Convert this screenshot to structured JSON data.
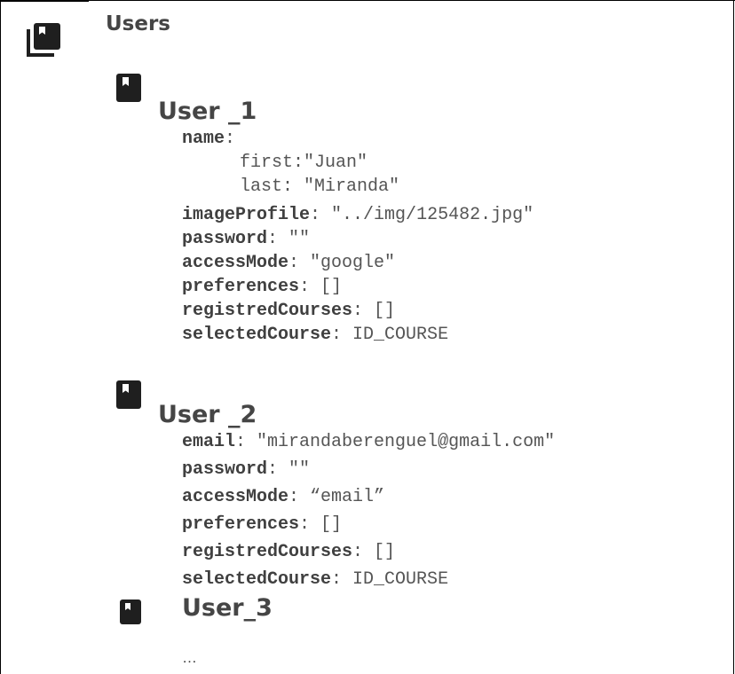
{
  "root": {
    "title": "Users",
    "icon": "collection-bookmark-icon"
  },
  "users": [
    {
      "title": "User _1",
      "icon": "bookmark-icon",
      "fields": [
        {
          "key": "name",
          "sep": ":",
          "value": ""
        },
        {
          "key": "",
          "sep": "",
          "value": "first:\"Juan\""
        },
        {
          "key": "",
          "sep": "",
          "value": "last: \"Miranda\""
        },
        {
          "key": "imageProfile",
          "sep": ": ",
          "value": "\"../img/125482.jpg\""
        },
        {
          "key": "password",
          "sep": ": ",
          "value": "\"\""
        },
        {
          "key": "accessMode",
          "sep": ": ",
          "value": "\"google\""
        },
        {
          "key": "preferences",
          "sep": ": ",
          "value": "[]"
        },
        {
          "key": "registredCourses",
          "sep": ": ",
          "value": "[]"
        },
        {
          "key": "selectedCourse",
          "sep": ": ",
          "value": "ID_COURSE"
        }
      ]
    },
    {
      "title": "User _2",
      "icon": "bookmark-icon",
      "fields": [
        {
          "key": "email",
          "sep": ": ",
          "value": "\"mirandaberenguel@gmail.com\""
        },
        {
          "key": "password",
          "sep": ": ",
          "value": "\"\""
        },
        {
          "key": "accessMode",
          "sep": ": ",
          "value": "“email”"
        },
        {
          "key": "preferences",
          "sep": ": ",
          "value": "[]"
        },
        {
          "key": "registredCourses",
          "sep": ": ",
          "value": "[]"
        },
        {
          "key": "selectedCourse",
          "sep": ": ",
          "value": "ID_COURSE"
        }
      ]
    },
    {
      "title": "User_3",
      "icon": "bookmark-icon",
      "fields": []
    }
  ],
  "more": "…"
}
